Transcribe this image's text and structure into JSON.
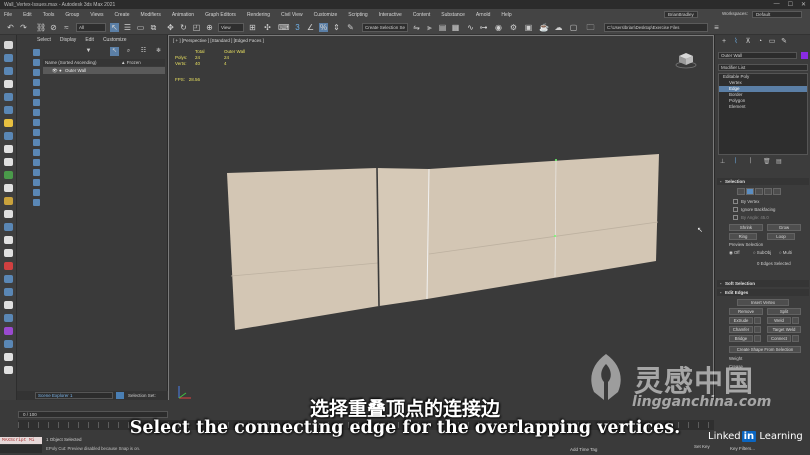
{
  "window": {
    "title": "Wall_Vertex-Issues.max - Autodesk 3ds Max 2021",
    "controls": [
      "—",
      "☐",
      "✕"
    ]
  },
  "menubar": {
    "items": [
      "File",
      "Edit",
      "Tools",
      "Group",
      "Views",
      "Create",
      "Modifiers",
      "Animation",
      "Graph Editors",
      "Rendering",
      "Civil View",
      "Customize",
      "Scripting",
      "Interactive",
      "Content",
      "Substance",
      "Arnold",
      "Help"
    ],
    "user": "BrianBradley",
    "workspaces_label": "Workspaces:",
    "workspaces_value": "Default"
  },
  "toolbar": {
    "filter_dropdown": "All",
    "view_dropdown": "View",
    "selection_set": "Create Selection Se",
    "project_path": "C:\\Users\\brian\\Desktop\\Exercise Files"
  },
  "scene_explorer": {
    "menu": [
      "Select",
      "Display",
      "Edit",
      "Customize"
    ],
    "col_name": "Name (Sorted Ascending)",
    "col_frozen": "▲ Frozen",
    "rows": [
      {
        "name": "Outer Wall"
      }
    ],
    "bottom_label": "Scene Explorer 1",
    "selection_set_label": "Selection Set:"
  },
  "viewport": {
    "label": "[ + ] [Perspective ] [Standard ] [Edged Faces ]",
    "stats": {
      "header_total": "Total",
      "header_object": "Outer Wall",
      "polys_label": "Polys:",
      "polys_total": "24",
      "polys_object": "24",
      "verts_label": "Verts:",
      "verts_total": "40",
      "verts_object": "4",
      "fps_label": "FPS:",
      "fps_value": "28.56"
    },
    "wall_color": "#d3c6b4"
  },
  "command_panel": {
    "object_name": "Outer Wall",
    "modifier_list": "Modifier List",
    "stack": [
      {
        "label": "Editable Poly",
        "root": true,
        "selected": false
      },
      {
        "label": "Vertex",
        "root": false,
        "selected": false
      },
      {
        "label": "Edge",
        "root": false,
        "selected": true
      },
      {
        "label": "Border",
        "root": false,
        "selected": false
      },
      {
        "label": "Polygon",
        "root": false,
        "selected": false
      },
      {
        "label": "Element",
        "root": false,
        "selected": false
      }
    ],
    "selection_rollout": "Selection",
    "by_vertex": "By Vertex",
    "ignore_backfacing": "Ignore Backfacing",
    "by_angle": "By Angle:",
    "by_angle_value": "45.0",
    "shrink": "Shrink",
    "grow": "Grow",
    "ring": "Ring",
    "loop": "Loop",
    "preview_selection": "Preview Selection",
    "preview_off": "Off",
    "preview_subobj": "SubObj",
    "preview_multi": "Multi",
    "edges_selected": "0 Edges Selected",
    "soft_selection_rollout": "Soft Selection",
    "edit_edges_rollout": "Edit Edges",
    "insert_vertex": "Insert Vertex",
    "remove": "Remove",
    "split": "Split",
    "extrude": "Extrude",
    "weld": "Weld",
    "chamfer": "Chamfer",
    "target_weld": "Target Weld",
    "bridge": "Bridge",
    "connect": "Connect",
    "create_shape": "Create Shape From Selection",
    "weight_label": "Weight",
    "crease_label": "Crease"
  },
  "bottom": {
    "time_slider": "0 / 100",
    "maxscript": "MAXScript Mi",
    "status_line1": "1 Object Selected",
    "status_line2": "EPoly Cut: Preview disabled because Snap is on.",
    "add_time_tag": "Add Time Tag",
    "set_key": "Set Key",
    "key_filters": "Key Filters..."
  },
  "subtitles": {
    "chinese": "选择重叠顶点的连接边",
    "english": "Select the connecting edge for the overlapping vertices."
  },
  "watermark": {
    "chinese": "灵感中国",
    "url": "lingganchina.com",
    "linkedin_prefix": "Linked",
    "linkedin_in": "in",
    "linkedin_suffix": " Learning"
  }
}
